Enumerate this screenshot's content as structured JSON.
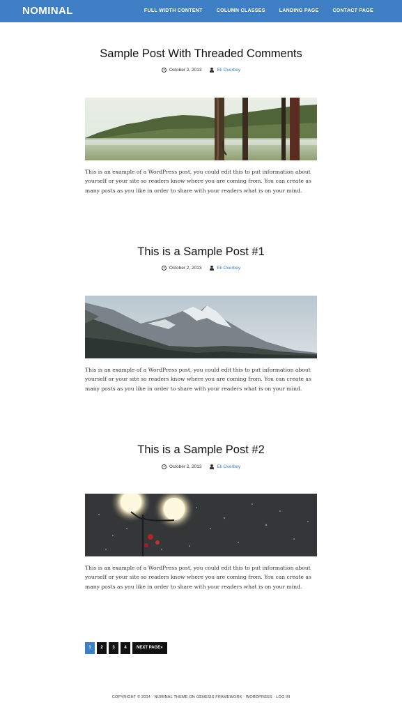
{
  "site": {
    "title": "NOMINAL"
  },
  "nav": {
    "items": [
      "FULL WIDTH CONTENT",
      "COLUMN CLASSES",
      "LANDING PAGE",
      "CONTACT PAGE"
    ]
  },
  "posts": [
    {
      "title": "Sample Post With Threaded Comments",
      "date": "October 2, 2013",
      "author": "Eli Overbey",
      "excerpt": "This is an example of a WordPress post, you could edit this to put information about yourself or your site so readers know where you are coming from. You can create as many posts as you like in order to share with your readers what is on your mind."
    },
    {
      "title": "This is a Sample Post #1",
      "date": "October 2, 2013",
      "author": "Eli Overbey",
      "excerpt": "This is an example of a WordPress post, you could edit this to put information about yourself or your site so readers know where you are coming from. You can create as many posts as you like in order to share with your readers what is on your mind."
    },
    {
      "title": "This is a Sample Post #2",
      "date": "October 2, 2013",
      "author": "Eli Overbey",
      "excerpt": "This is an example of a WordPress post, you could edit this to put information about yourself or your site so readers know where you are coming from. You can create as many posts as you like in order to share with your readers what is on your mind."
    }
  ],
  "pagination": {
    "pages": [
      "1",
      "2",
      "3",
      "4"
    ],
    "current": "1",
    "next": "NEXT PAGE»"
  },
  "footer": {
    "text": "COPYRIGHT © 2014 · NOMINAL THEME ON GENESIS FRAMEWORK · WORDPRESS · LOG IN"
  },
  "colors": {
    "accent": "#3d7ec4",
    "text": "#222222",
    "pager": "#111111"
  },
  "icons": {
    "date": "clock-icon",
    "author": "user-icon"
  }
}
